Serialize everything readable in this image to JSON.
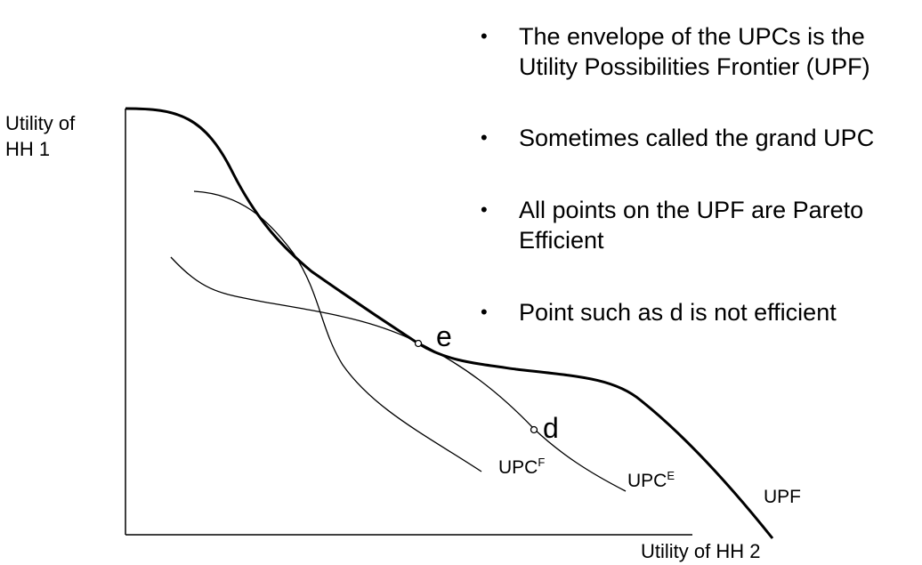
{
  "axes": {
    "y_label_line1": "Utility of",
    "y_label_line2": "HH 1",
    "x_label": "Utility of HH 2"
  },
  "curves": {
    "upf": {
      "label": "UPF"
    },
    "upc_f": {
      "label_base": "UPC",
      "label_sup": "F"
    },
    "upc_e": {
      "label_base": "UPC",
      "label_sup": "E"
    }
  },
  "points": {
    "e": {
      "label": "e"
    },
    "d": {
      "label": "d"
    }
  },
  "bullets": [
    {
      "marker": "•",
      "lines": [
        "The envelope of the UPCs is the",
        "Utility Possibilities Frontier (UPF)"
      ]
    },
    {
      "marker": "•",
      "lines": [
        "Sometimes called the grand UPC"
      ]
    },
    {
      "marker": "•",
      "lines": [
        "All points on the UPF are Pareto",
        "Efficient"
      ]
    },
    {
      "marker": "•",
      "lines": [
        "Point such as d is not efficient"
      ]
    }
  ],
  "colors": {
    "line": "#000000",
    "background": "#ffffff"
  }
}
